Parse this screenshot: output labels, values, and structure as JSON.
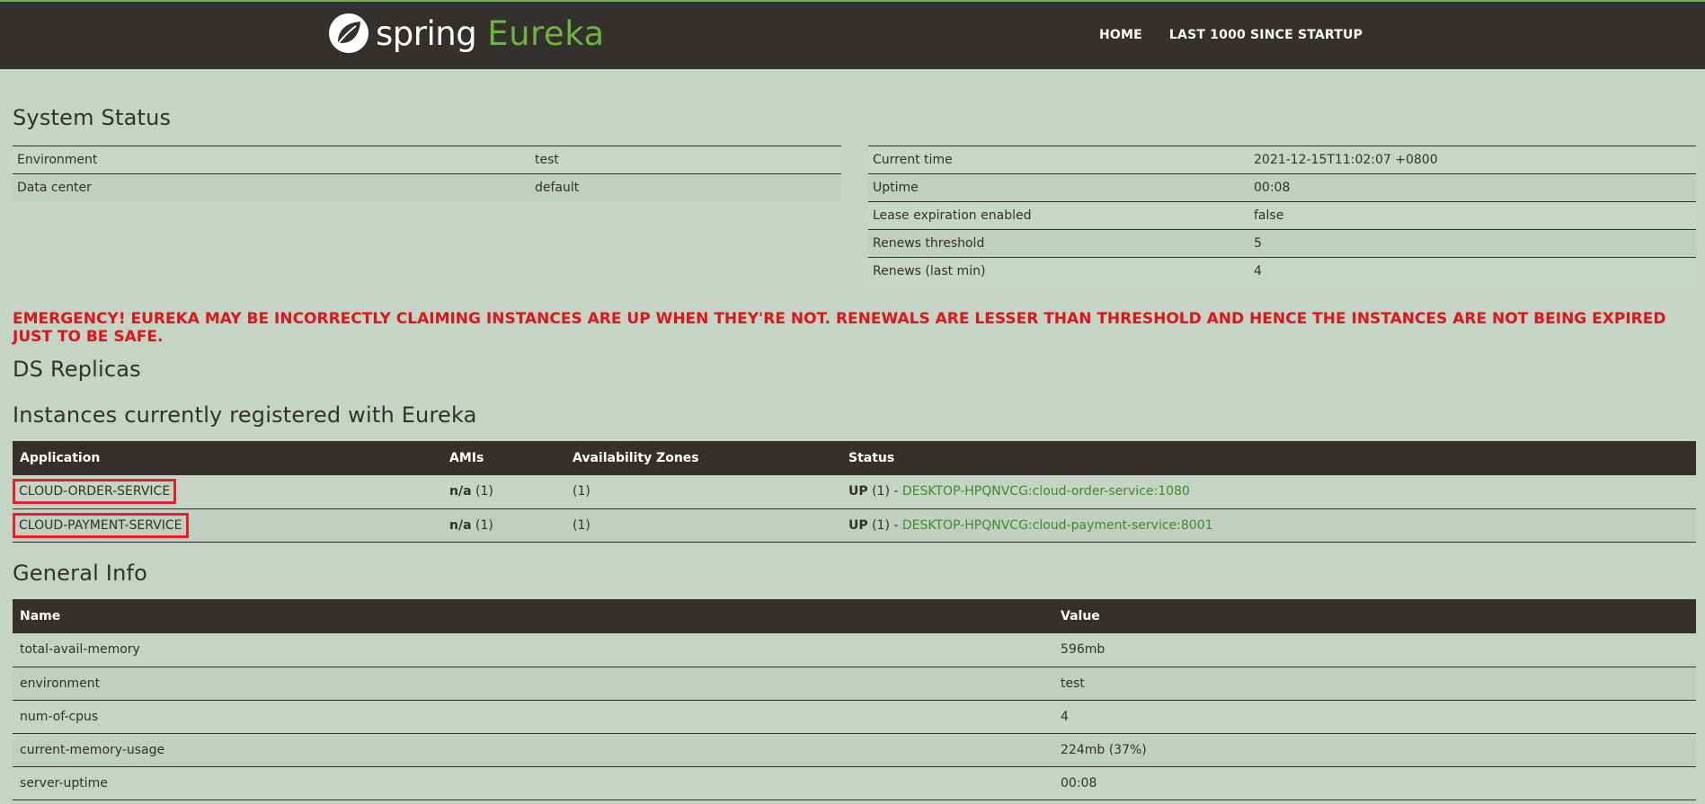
{
  "header": {
    "brand_spring": "spring",
    "brand_eureka": "Eureka",
    "nav": [
      "HOME",
      "LAST 1000 SINCE STARTUP"
    ]
  },
  "system_status": {
    "title": "System Status",
    "left": [
      {
        "label": "Environment",
        "value": "test"
      },
      {
        "label": "Data center",
        "value": "default"
      }
    ],
    "right": [
      {
        "label": "Current time",
        "value": "2021-12-15T11:02:07 +0800"
      },
      {
        "label": "Uptime",
        "value": "00:08"
      },
      {
        "label": "Lease expiration enabled",
        "value": "false"
      },
      {
        "label": "Renews threshold",
        "value": "5"
      },
      {
        "label": "Renews (last min)",
        "value": "4"
      }
    ]
  },
  "emergency": "EMERGENCY! EUREKA MAY BE INCORRECTLY CLAIMING INSTANCES ARE UP WHEN THEY'RE NOT. RENEWALS ARE LESSER THAN THRESHOLD AND HENCE THE INSTANCES ARE NOT BEING EXPIRED JUST TO BE SAFE.",
  "ds_replicas": {
    "title": "DS Replicas"
  },
  "instances": {
    "title": "Instances currently registered with Eureka",
    "columns": [
      "Application",
      "AMIs",
      "Availability Zones",
      "Status"
    ],
    "rows": [
      {
        "application": "CLOUD-ORDER-SERVICE",
        "amis_bold": "n/a",
        "amis_count": "(1)",
        "zones": "(1)",
        "status_bold": "UP",
        "status_count": "(1) -",
        "instance": "DESKTOP-HPQNVCG:cloud-order-service:1080"
      },
      {
        "application": "CLOUD-PAYMENT-SERVICE",
        "amis_bold": "n/a",
        "amis_count": "(1)",
        "zones": "(1)",
        "status_bold": "UP",
        "status_count": "(1) -",
        "instance": "DESKTOP-HPQNVCG:cloud-payment-service:8001"
      }
    ]
  },
  "general_info": {
    "title": "General Info",
    "columns": [
      "Name",
      "Value"
    ],
    "rows": [
      {
        "name": "total-avail-memory",
        "value": "596mb"
      },
      {
        "name": "environment",
        "value": "test"
      },
      {
        "name": "num-of-cpus",
        "value": "4"
      },
      {
        "name": "current-memory-usage",
        "value": "224mb (37%)"
      },
      {
        "name": "server-uptime",
        "value": "00:08"
      }
    ]
  },
  "colors": {
    "background": "#c5d4c5",
    "header": "#34302d",
    "spring_green": "#6db33f",
    "emergency_red": "#e0141a",
    "highlight_box": "#e8202a"
  },
  "icons": {
    "brand_logo": "spring-leaf-icon"
  }
}
